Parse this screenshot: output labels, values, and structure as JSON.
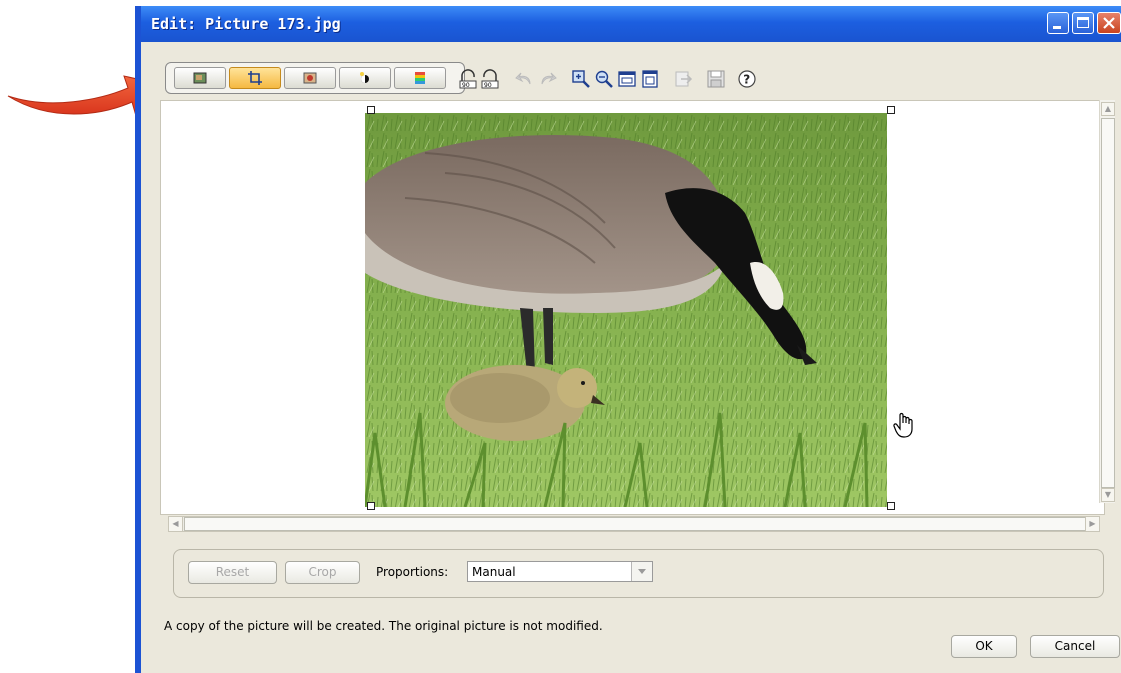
{
  "window": {
    "title": "Edit:  Picture 173.jpg"
  },
  "toolbar": {
    "tools": [
      {
        "icon": "picture-icon"
      },
      {
        "icon": "crop-icon",
        "active": true
      },
      {
        "icon": "red-eye-icon"
      },
      {
        "icon": "brightness-icon"
      },
      {
        "icon": "color-icon"
      }
    ],
    "icons": [
      "rotate-left-icon",
      "rotate-right-icon",
      "undo-icon",
      "redo-icon",
      "zoom-in-icon",
      "zoom-out-icon",
      "fit-window-icon",
      "actual-size-icon",
      "export-icon",
      "save-icon",
      "help-icon"
    ],
    "help_glyph": "?"
  },
  "crop_panel": {
    "reset_label": "Reset",
    "crop_label": "Crop",
    "proportions_label": "Proportions:",
    "proportions_value": "Manual"
  },
  "footer": {
    "note": "A copy of the picture will be created. The original picture is not modified.",
    "ok_label": "OK",
    "cancel_label": "Cancel"
  },
  "colors": {
    "title_bar": "#1c5fe0",
    "active_tool": "#f5b942",
    "annotation_arrow": "#e8472a"
  }
}
